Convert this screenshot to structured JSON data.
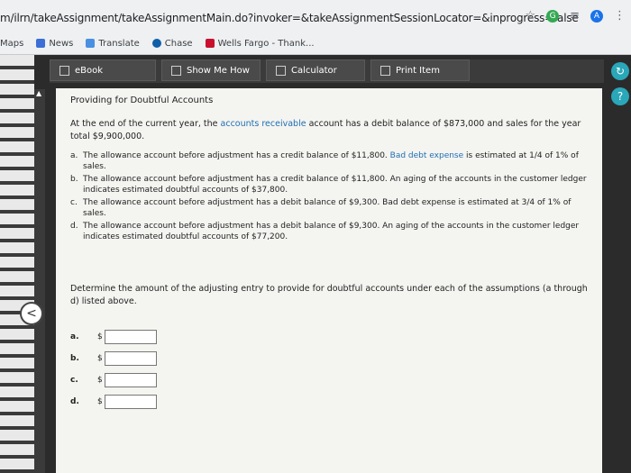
{
  "browser": {
    "url": "m/ilrn/takeAssignment/takeAssignmentMain.do?invoker=&takeAssignmentSessionLocator=&inprogress=false",
    "bookmarks": [
      {
        "label": "Maps",
        "icon": "maps-icon"
      },
      {
        "label": "News",
        "icon": "news-icon"
      },
      {
        "label": "Translate",
        "icon": "translate-icon"
      },
      {
        "label": "Chase",
        "icon": "chase-icon"
      },
      {
        "label": "Wells Fargo - Thank...",
        "icon": "wells-fargo-icon"
      }
    ],
    "profile_letter": "A"
  },
  "toolbar": {
    "ebook": "eBook",
    "show_me_how": "Show Me How",
    "calculator": "Calculator",
    "print_item": "Print Item"
  },
  "problem": {
    "title": "Providing for Doubtful Accounts",
    "intro_pre": "At the end of the current year, the ",
    "intro_link": "accounts receivable",
    "intro_post": " account has a debit balance of $873,000 and sales for the year total $9,900,000.",
    "items": [
      {
        "letter": "a.",
        "pre": "The allowance account before adjustment has a credit balance of $11,800. ",
        "link": "Bad debt expense",
        "post": " is estimated at 1/4 of 1% of sales."
      },
      {
        "letter": "b.",
        "pre": "The allowance account before adjustment has a credit balance of $11,800. An aging of the accounts in the customer ledger indicates estimated doubtful accounts of $37,800.",
        "link": "",
        "post": ""
      },
      {
        "letter": "c.",
        "pre": "The allowance account before adjustment has a debit balance of $9,300. Bad debt expense is estimated at 3/4 of 1% of sales.",
        "link": "",
        "post": ""
      },
      {
        "letter": "d.",
        "pre": "The allowance account before adjustment has a debit balance of $9,300. An aging of the accounts in the customer ledger indicates estimated doubtful accounts of $77,200.",
        "link": "",
        "post": ""
      }
    ],
    "instruction": "Determine the amount of the adjusting entry to provide for doubtful accounts under each of the assumptions (a through d) listed above.",
    "answers": [
      {
        "label": "a.",
        "currency": "$",
        "value": ""
      },
      {
        "label": "b.",
        "currency": "$",
        "value": ""
      },
      {
        "label": "c.",
        "currency": "$",
        "value": ""
      },
      {
        "label": "d.",
        "currency": "$",
        "value": ""
      }
    ]
  }
}
